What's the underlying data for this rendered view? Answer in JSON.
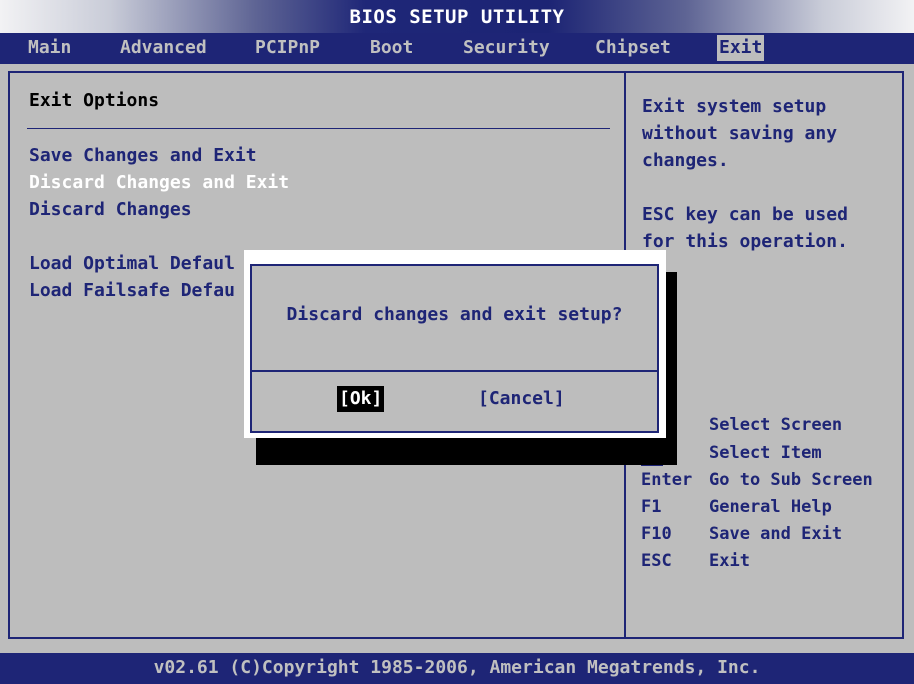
{
  "title": "BIOS SETUP UTILITY",
  "menu": [
    "Main",
    "Advanced",
    "PCIPnP",
    "Boot",
    "Security",
    "Chipset",
    "Exit"
  ],
  "active_menu": "Exit",
  "section_title": "Exit Options",
  "options": [
    "Save Changes and Exit",
    "Discard Changes and Exit",
    "Discard Changes",
    "Load Optimal Defaul",
    "Load Failsafe Defau"
  ],
  "selected_option": "Discard Changes and Exit",
  "help": {
    "line1": "Exit system setup\nwithout saving any\nchanges.",
    "line2": "ESC key can be used\nfor this operation."
  },
  "legend": [
    {
      "key": "",
      "desc": "Select Screen"
    },
    {
      "key": "↑↓",
      "desc": "Select Item"
    },
    {
      "key": "Enter",
      "desc": "Go to Sub Screen"
    },
    {
      "key": "F1",
      "desc": "General Help"
    },
    {
      "key": "F10",
      "desc": "Save and Exit"
    },
    {
      "key": "ESC",
      "desc": "Exit"
    }
  ],
  "dialog": {
    "message": "Discard changes and exit setup?",
    "ok_label": "[Ok]",
    "cancel_label": "[Cancel]"
  },
  "footer": "v02.61 (C)Copyright 1985-2006, American Megatrends, Inc.",
  "colors": {
    "navy": "#1e2576",
    "panel": "#bdbdbd",
    "selected_text": "#ffffff"
  }
}
